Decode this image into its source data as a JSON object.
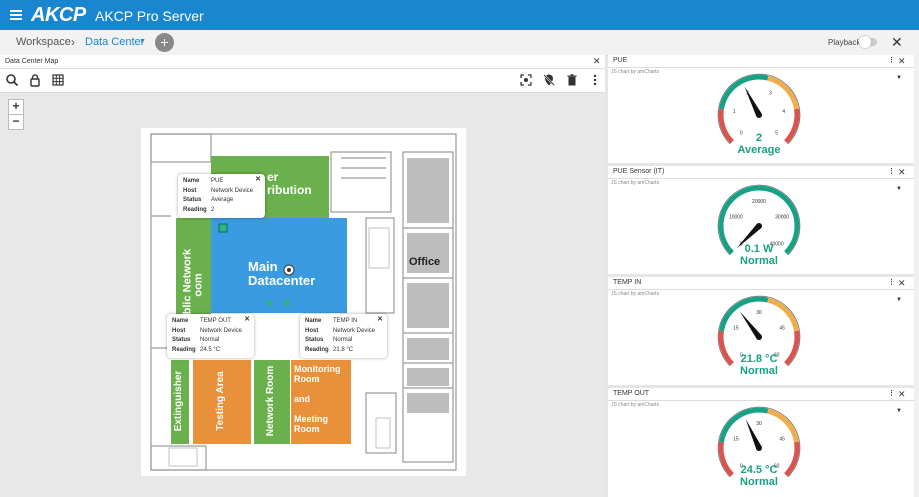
{
  "app": {
    "logo": "AKCP",
    "title": "AKCP Pro Server"
  },
  "breadcrumb": {
    "workspace": "Workspace",
    "current": "Data Center",
    "playback": "Playback"
  },
  "map": {
    "panel_title": "Data Center Map",
    "rooms": {
      "power_distribution": "er\nribution",
      "public_network": "ublic Network\noom",
      "main_datacenter": "Main\nDatacenter",
      "office": "Office",
      "extinguisher": "Extinguisher",
      "testing_area": "Testing Area",
      "network_room": "Network Room",
      "monitoring_room": "Monitoring\nRoom\n\nand\n\nMeeting\nRoom"
    },
    "tooltips": [
      {
        "name_label": "Name",
        "name": "PUE",
        "host_label": "Host",
        "host": "Network Device",
        "status_label": "Status",
        "status": "Average",
        "reading_label": "Reading",
        "reading": "2"
      },
      {
        "name_label": "Name",
        "name": "TEMP OUT",
        "host_label": "Host",
        "host": "Network Device",
        "status_label": "Status",
        "status": "Normal",
        "reading_label": "Reading",
        "reading": "24.5 °C"
      },
      {
        "name_label": "Name",
        "name": "TEMP IN",
        "host_label": "Host",
        "host": "Network Device",
        "status_label": "Status",
        "status": "Normal",
        "reading_label": "Reading",
        "reading": "21.8 °C"
      }
    ]
  },
  "widgets": [
    {
      "title": "PUE",
      "credit": "JS chart by amCharts",
      "value": "2",
      "status": "Average",
      "min": 0,
      "max": 5,
      "reading": 2,
      "ticks": [
        "0",
        "1",
        "2",
        "3",
        "4",
        "5"
      ]
    },
    {
      "title": "PUE Sensor (IT)",
      "credit": "JS chart by amCharts",
      "value": "0.1 W",
      "status": "Normal",
      "min": 0,
      "max": 40000,
      "reading": 0.1,
      "ticks": [
        "0",
        "10000",
        "20000",
        "30000",
        "40000"
      ]
    },
    {
      "title": "TEMP IN",
      "credit": "JS chart by amCharts",
      "value": "21.8 °C",
      "status": "Normal",
      "min": 0,
      "max": 60,
      "reading": 21.8,
      "ticks": [
        "0",
        "15",
        "30",
        "45",
        "60"
      ]
    },
    {
      "title": "TEMP OUT",
      "credit": "JS chart by amCharts",
      "value": "24.5 °C",
      "status": "Normal",
      "min": 0,
      "max": 60,
      "reading": 24.5,
      "ticks": [
        "0",
        "15",
        "30",
        "45",
        "60"
      ]
    }
  ],
  "colors": {
    "accent": "#1a86d0",
    "value_text": "#17a185",
    "gauge_red": "#d9534f",
    "gauge_orange": "#f0ad4e",
    "gauge_green": "#17a185",
    "room_green": "#6ab04c",
    "room_blue": "#3b9be0",
    "room_orange": "#e8913a"
  }
}
